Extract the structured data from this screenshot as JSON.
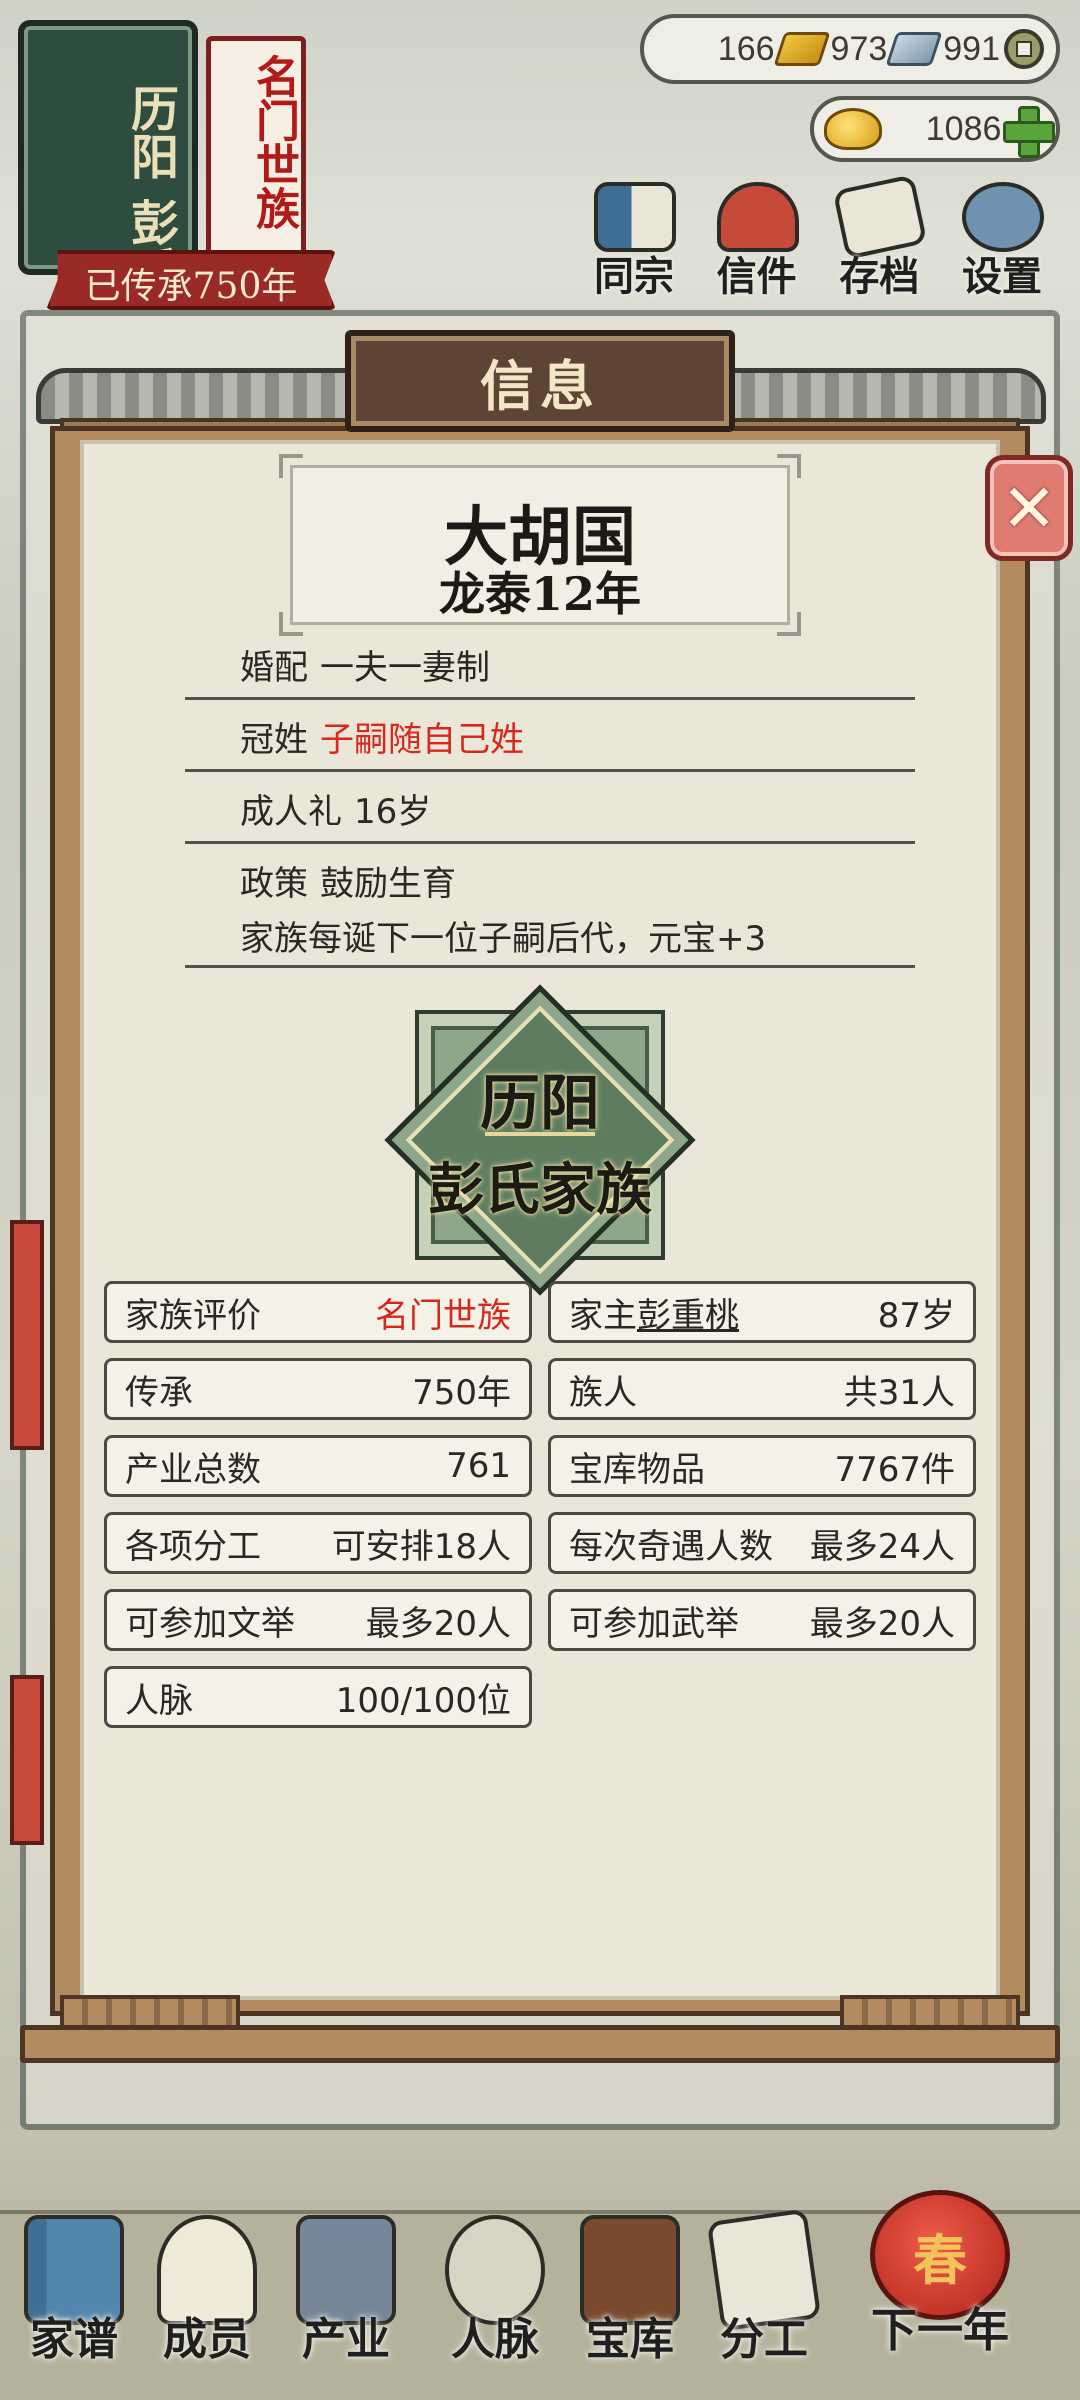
{
  "family": {
    "region": "历阳",
    "surname": "彭氏",
    "rank": "名门世族",
    "heritage": "已传承750年"
  },
  "currency": {
    "gold": "166",
    "silver": "973",
    "coins": "991",
    "ingots": "1086"
  },
  "top_menu": [
    "同宗",
    "信件",
    "存档",
    "设置"
  ],
  "panel": {
    "title": "信息",
    "nation": "大胡国",
    "era": "龙泰12年",
    "close_glyph": "✕"
  },
  "info": {
    "marriage": {
      "k": "婚配",
      "v": "一夫一妻制"
    },
    "surname_rule": {
      "k": "冠姓",
      "v": "子嗣随自己姓"
    },
    "adulthood": {
      "k": "成人礼",
      "v": "16岁"
    },
    "policy": {
      "k": "政策",
      "v": "鼓励生育",
      "desc": "家族每诞下一位子嗣后代，元宝+3"
    }
  },
  "emblem": {
    "line1": "历阳",
    "line2": "彭氏家族"
  },
  "stats": {
    "rating": {
      "k": "家族评价",
      "v": "名门世族"
    },
    "head": {
      "k": "家主",
      "name": "彭重桃",
      "v": "87岁"
    },
    "heritage": {
      "k": "传承",
      "v": "750年"
    },
    "members": {
      "k": "族人",
      "v": "共31人"
    },
    "industry": {
      "k": "产业总数",
      "v": "761"
    },
    "treasury": {
      "k": "宝库物品",
      "v": "7767件"
    },
    "labor": {
      "k": "各项分工",
      "v": "可安排18人"
    },
    "encounter": {
      "k": "每次奇遇人数",
      "v": "最多24人"
    },
    "civil_exam": {
      "k": "可参加文举",
      "v": "最多20人"
    },
    "military_exam": {
      "k": "可参加武举",
      "v": "最多20人"
    },
    "connections": {
      "k": "人脉",
      "v": "100/100位"
    }
  },
  "bottom_nav": [
    "家谱",
    "成员",
    "产业",
    "人脉",
    "宝库",
    "分工",
    "下一年"
  ],
  "next_year_glyph": "春",
  "colors": {
    "accent_red": "#d6281f",
    "panel_paper": "#ebe7d8",
    "board_green": "#2f4d3f"
  }
}
